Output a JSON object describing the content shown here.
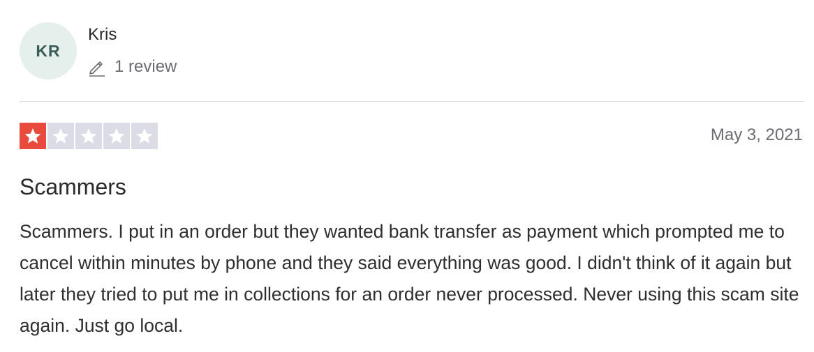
{
  "reviewer": {
    "initials": "KR",
    "name": "Kris",
    "review_count": "1 review"
  },
  "rating": {
    "value": 1,
    "max": 5,
    "filled_color": "#e84a3c",
    "empty_color": "#dcdce6"
  },
  "review": {
    "date": "May 3, 2021",
    "title": "Scammers",
    "body": "Scammers. I put in an order but they wanted bank transfer as payment which prompted me to cancel within minutes by phone and they said everything was good. I didn't think of it again but later they tried to put me in collections for an order never processed. Never using this scam site again. Just go local."
  },
  "icons": {
    "review_count": "pencil-icon",
    "rating": "star-icon"
  }
}
